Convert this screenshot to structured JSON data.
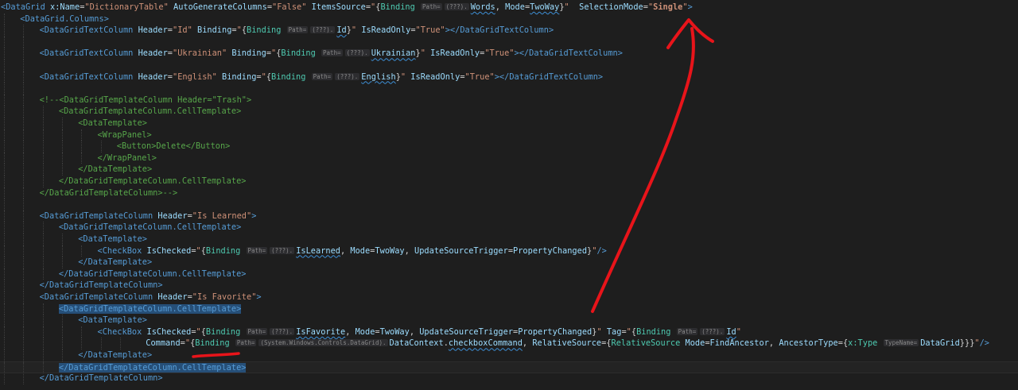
{
  "colors": {
    "background": "#1e1e1e",
    "tag": "#569cd6",
    "attribute": "#9cdcfe",
    "string": "#ce9178",
    "markup_extension": "#4ec9b0",
    "comment": "#57a64a",
    "property": "#dcdcaa",
    "selection": "#264f78",
    "annotation": "#e8141a"
  },
  "code_lines": [
    {
      "indent": 0,
      "tokens": [
        {
          "t": "<",
          "c": "t-tag"
        },
        {
          "t": "DataGrid",
          "c": "t-tag"
        },
        {
          "t": " x:Name",
          "c": "t-attr"
        },
        {
          "t": "=",
          "c": "t-brace"
        },
        {
          "t": "\"DictionaryTable\"",
          "c": "t-str"
        },
        {
          "t": " AutoGenerateColumns",
          "c": "t-attr"
        },
        {
          "t": "=",
          "c": "t-brace"
        },
        {
          "t": "\"False\"",
          "c": "t-str"
        },
        {
          "t": " ItemsSource",
          "c": "t-attr"
        },
        {
          "t": "=",
          "c": "t-brace"
        },
        {
          "t": "\"",
          "c": "t-str"
        },
        {
          "t": "{",
          "c": "t-brace"
        },
        {
          "t": "Binding",
          "c": "t-ext"
        },
        {
          "t": " "
        },
        {
          "t": "Path=",
          "c": "t-inlay"
        },
        {
          "t": "(???).",
          "c": "t-inlay"
        },
        {
          "t": "Words",
          "c": "t-path",
          "sq": true
        },
        {
          "t": ", ",
          "c": "t-brace"
        },
        {
          "t": "Mode",
          "c": "t-attr"
        },
        {
          "t": "=",
          "c": "t-brace"
        },
        {
          "t": "TwoWay",
          "c": "t-attr",
          "sq": true
        },
        {
          "t": "}",
          "c": "t-brace"
        },
        {
          "t": "\"",
          "c": "t-str"
        },
        {
          "t": "  SelectionMode",
          "c": "t-attr"
        },
        {
          "t": "=",
          "c": "t-brace"
        },
        {
          "t": "\"",
          "c": "t-str"
        },
        {
          "t": "Single",
          "c": "t-bold"
        },
        {
          "t": "\"",
          "c": "t-str"
        },
        {
          "t": ">",
          "c": "t-tag"
        }
      ]
    },
    {
      "indent": 1,
      "tokens": [
        {
          "t": "<",
          "c": "t-tag"
        },
        {
          "t": "DataGrid.Columns",
          "c": "t-tag"
        },
        {
          "t": ">",
          "c": "t-tag"
        }
      ]
    },
    {
      "indent": 2,
      "tokens": [
        {
          "t": "<",
          "c": "t-tag"
        },
        {
          "t": "DataGridTextColumn",
          "c": "t-tag"
        },
        {
          "t": " Header",
          "c": "t-attr"
        },
        {
          "t": "=",
          "c": "t-brace"
        },
        {
          "t": "\"Id\"",
          "c": "t-str"
        },
        {
          "t": " Binding",
          "c": "t-attr"
        },
        {
          "t": "=",
          "c": "t-brace"
        },
        {
          "t": "\"",
          "c": "t-str"
        },
        {
          "t": "{",
          "c": "t-brace"
        },
        {
          "t": "Binding",
          "c": "t-ext"
        },
        {
          "t": " "
        },
        {
          "t": "Path=",
          "c": "t-inlay"
        },
        {
          "t": "(???).",
          "c": "t-inlay"
        },
        {
          "t": "Id",
          "c": "t-path",
          "sq": true
        },
        {
          "t": "}",
          "c": "t-brace"
        },
        {
          "t": "\"",
          "c": "t-str"
        },
        {
          "t": " IsReadOnly",
          "c": "t-attr"
        },
        {
          "t": "=",
          "c": "t-brace"
        },
        {
          "t": "\"True\"",
          "c": "t-str"
        },
        {
          "t": "></",
          "c": "t-tag"
        },
        {
          "t": "DataGridTextColumn",
          "c": "t-tag"
        },
        {
          "t": ">",
          "c": "t-tag"
        }
      ]
    },
    {
      "indent": 2,
      "tokens": []
    },
    {
      "indent": 2,
      "tokens": [
        {
          "t": "<",
          "c": "t-tag"
        },
        {
          "t": "DataGridTextColumn",
          "c": "t-tag"
        },
        {
          "t": " Header",
          "c": "t-attr"
        },
        {
          "t": "=",
          "c": "t-brace"
        },
        {
          "t": "\"Ukrainian\"",
          "c": "t-str"
        },
        {
          "t": " Binding",
          "c": "t-attr"
        },
        {
          "t": "=",
          "c": "t-brace"
        },
        {
          "t": "\"",
          "c": "t-str"
        },
        {
          "t": "{",
          "c": "t-brace"
        },
        {
          "t": "Binding",
          "c": "t-ext"
        },
        {
          "t": " "
        },
        {
          "t": "Path=",
          "c": "t-inlay"
        },
        {
          "t": "(???).",
          "c": "t-inlay"
        },
        {
          "t": "Ukrainian",
          "c": "t-path",
          "sq": true
        },
        {
          "t": "}",
          "c": "t-brace"
        },
        {
          "t": "\"",
          "c": "t-str"
        },
        {
          "t": " IsReadOnly",
          "c": "t-attr"
        },
        {
          "t": "=",
          "c": "t-brace"
        },
        {
          "t": "\"True\"",
          "c": "t-str"
        },
        {
          "t": "></",
          "c": "t-tag"
        },
        {
          "t": "DataGridTextColumn",
          "c": "t-tag"
        },
        {
          "t": ">",
          "c": "t-tag"
        }
      ]
    },
    {
      "indent": 2,
      "tokens": []
    },
    {
      "indent": 2,
      "tokens": [
        {
          "t": "<",
          "c": "t-tag"
        },
        {
          "t": "DataGridTextColumn",
          "c": "t-tag"
        },
        {
          "t": " Header",
          "c": "t-attr"
        },
        {
          "t": "=",
          "c": "t-brace"
        },
        {
          "t": "\"English\"",
          "c": "t-str"
        },
        {
          "t": " Binding",
          "c": "t-attr"
        },
        {
          "t": "=",
          "c": "t-brace"
        },
        {
          "t": "\"",
          "c": "t-str"
        },
        {
          "t": "{",
          "c": "t-brace"
        },
        {
          "t": "Binding",
          "c": "t-ext"
        },
        {
          "t": " "
        },
        {
          "t": "Path=",
          "c": "t-inlay"
        },
        {
          "t": "(???).",
          "c": "t-inlay"
        },
        {
          "t": "English",
          "c": "t-path",
          "sq": true
        },
        {
          "t": "}",
          "c": "t-brace"
        },
        {
          "t": "\"",
          "c": "t-str"
        },
        {
          "t": " IsReadOnly",
          "c": "t-attr"
        },
        {
          "t": "=",
          "c": "t-brace"
        },
        {
          "t": "\"True\"",
          "c": "t-str"
        },
        {
          "t": "></",
          "c": "t-tag"
        },
        {
          "t": "DataGridTextColumn",
          "c": "t-tag"
        },
        {
          "t": ">",
          "c": "t-tag"
        }
      ]
    },
    {
      "indent": 2,
      "tokens": []
    },
    {
      "indent": 2,
      "tokens": [
        {
          "t": "<!--<DataGridTemplateColumn Header=\"Trash\">",
          "c": "t-com"
        }
      ]
    },
    {
      "indent": 3,
      "tokens": [
        {
          "t": "<DataGridTemplateColumn.CellTemplate>",
          "c": "t-com"
        }
      ]
    },
    {
      "indent": 4,
      "tokens": [
        {
          "t": "<DataTemplate>",
          "c": "t-com"
        }
      ]
    },
    {
      "indent": 5,
      "tokens": [
        {
          "t": "<WrapPanel>",
          "c": "t-com"
        }
      ]
    },
    {
      "indent": 6,
      "tokens": [
        {
          "t": "<Button>Delete</Button>",
          "c": "t-com"
        }
      ]
    },
    {
      "indent": 5,
      "tokens": [
        {
          "t": "</WrapPanel>",
          "c": "t-com"
        }
      ]
    },
    {
      "indent": 4,
      "tokens": [
        {
          "t": "</DataTemplate>",
          "c": "t-com"
        }
      ]
    },
    {
      "indent": 3,
      "tokens": [
        {
          "t": "</DataGridTemplateColumn.CellTemplate>",
          "c": "t-com"
        }
      ]
    },
    {
      "indent": 2,
      "tokens": [
        {
          "t": "</DataGridTemplateColumn>-->",
          "c": "t-com"
        }
      ]
    },
    {
      "indent": 2,
      "tokens": []
    },
    {
      "indent": 2,
      "tokens": [
        {
          "t": "<",
          "c": "t-tag"
        },
        {
          "t": "DataGridTemplateColumn",
          "c": "t-tag"
        },
        {
          "t": " Header",
          "c": "t-attr"
        },
        {
          "t": "=",
          "c": "t-brace"
        },
        {
          "t": "\"Is Learned\"",
          "c": "t-str"
        },
        {
          "t": ">",
          "c": "t-tag"
        }
      ]
    },
    {
      "indent": 3,
      "tokens": [
        {
          "t": "<",
          "c": "t-tag"
        },
        {
          "t": "DataGridTemplateColumn.CellTemplate",
          "c": "t-tag"
        },
        {
          "t": ">",
          "c": "t-tag"
        }
      ]
    },
    {
      "indent": 4,
      "tokens": [
        {
          "t": "<",
          "c": "t-tag"
        },
        {
          "t": "DataTemplate",
          "c": "t-tag"
        },
        {
          "t": ">",
          "c": "t-tag"
        }
      ]
    },
    {
      "indent": 5,
      "tokens": [
        {
          "t": "<",
          "c": "t-tag"
        },
        {
          "t": "CheckBox",
          "c": "t-tag"
        },
        {
          "t": " IsChecked",
          "c": "t-attr"
        },
        {
          "t": "=",
          "c": "t-brace"
        },
        {
          "t": "\"",
          "c": "t-str"
        },
        {
          "t": "{",
          "c": "t-brace"
        },
        {
          "t": "Binding",
          "c": "t-ext"
        },
        {
          "t": " "
        },
        {
          "t": "Path=",
          "c": "t-inlay"
        },
        {
          "t": "(???).",
          "c": "t-inlay"
        },
        {
          "t": "IsLearned",
          "c": "t-path",
          "sq": true
        },
        {
          "t": ", ",
          "c": "t-brace"
        },
        {
          "t": "Mode",
          "c": "t-attr"
        },
        {
          "t": "=",
          "c": "t-brace"
        },
        {
          "t": "TwoWay",
          "c": "t-attr"
        },
        {
          "t": ", ",
          "c": "t-brace"
        },
        {
          "t": "UpdateSourceTrigger",
          "c": "t-attr"
        },
        {
          "t": "=",
          "c": "t-brace"
        },
        {
          "t": "PropertyChanged",
          "c": "t-attr"
        },
        {
          "t": "}",
          "c": "t-brace"
        },
        {
          "t": "\"",
          "c": "t-str"
        },
        {
          "t": "/>",
          "c": "t-tag"
        }
      ]
    },
    {
      "indent": 4,
      "tokens": [
        {
          "t": "</",
          "c": "t-tag"
        },
        {
          "t": "DataTemplate",
          "c": "t-tag"
        },
        {
          "t": ">",
          "c": "t-tag"
        }
      ]
    },
    {
      "indent": 3,
      "tokens": [
        {
          "t": "</",
          "c": "t-tag"
        },
        {
          "t": "DataGridTemplateColumn.CellTemplate",
          "c": "t-tag"
        },
        {
          "t": ">",
          "c": "t-tag"
        }
      ]
    },
    {
      "indent": 2,
      "tokens": [
        {
          "t": "</",
          "c": "t-tag"
        },
        {
          "t": "DataGridTemplateColumn",
          "c": "t-tag"
        },
        {
          "t": ">",
          "c": "t-tag"
        }
      ]
    },
    {
      "indent": 2,
      "tokens": [
        {
          "t": "<",
          "c": "t-tag"
        },
        {
          "t": "DataGridTemplateColumn",
          "c": "t-tag"
        },
        {
          "t": " Header",
          "c": "t-attr"
        },
        {
          "t": "=",
          "c": "t-brace"
        },
        {
          "t": "\"Is Favorite\"",
          "c": "t-str"
        },
        {
          "t": ">",
          "c": "t-tag"
        }
      ]
    },
    {
      "indent": 3,
      "tokens": [
        {
          "t": "<DataGridTemplateColumn.CellTemplate>",
          "c": "t-tag",
          "hl": true
        }
      ]
    },
    {
      "indent": 4,
      "tokens": [
        {
          "t": "<",
          "c": "t-tag"
        },
        {
          "t": "DataTemplate",
          "c": "t-tag"
        },
        {
          "t": ">",
          "c": "t-tag"
        }
      ]
    },
    {
      "indent": 5,
      "tokens": [
        {
          "t": "<",
          "c": "t-tag"
        },
        {
          "t": "CheckBox",
          "c": "t-tag"
        },
        {
          "t": " IsChecked",
          "c": "t-attr"
        },
        {
          "t": "=",
          "c": "t-brace"
        },
        {
          "t": "\"",
          "c": "t-str"
        },
        {
          "t": "{",
          "c": "t-brace"
        },
        {
          "t": "Binding",
          "c": "t-ext"
        },
        {
          "t": " "
        },
        {
          "t": "Path=",
          "c": "t-inlay"
        },
        {
          "t": "(???).",
          "c": "t-inlay"
        },
        {
          "t": "IsFavorite",
          "c": "t-path",
          "sq": true
        },
        {
          "t": ", ",
          "c": "t-brace"
        },
        {
          "t": "Mode",
          "c": "t-attr"
        },
        {
          "t": "=",
          "c": "t-brace"
        },
        {
          "t": "TwoWay",
          "c": "t-attr"
        },
        {
          "t": ", ",
          "c": "t-brace"
        },
        {
          "t": "UpdateSourceTrigger",
          "c": "t-attr"
        },
        {
          "t": "=",
          "c": "t-brace"
        },
        {
          "t": "PropertyChanged",
          "c": "t-attr"
        },
        {
          "t": "}",
          "c": "t-brace"
        },
        {
          "t": "\"",
          "c": "t-str"
        },
        {
          "t": " Tag",
          "c": "t-attr"
        },
        {
          "t": "=",
          "c": "t-brace"
        },
        {
          "t": "\"",
          "c": "t-str"
        },
        {
          "t": "{",
          "c": "t-brace"
        },
        {
          "t": "Binding",
          "c": "t-ext"
        },
        {
          "t": " "
        },
        {
          "t": "Path=",
          "c": "t-inlay"
        },
        {
          "t": "(???).",
          "c": "t-inlay"
        },
        {
          "t": "Id",
          "c": "t-path",
          "sq": true
        },
        {
          "t": "\"",
          "c": "t-str"
        }
      ]
    },
    {
      "indent": 7.5,
      "tokens": [
        {
          "t": "Command",
          "c": "t-attr"
        },
        {
          "t": "=",
          "c": "t-brace"
        },
        {
          "t": "\"",
          "c": "t-str"
        },
        {
          "t": "{",
          "c": "t-brace"
        },
        {
          "t": "Binding",
          "c": "t-ext"
        },
        {
          "t": " "
        },
        {
          "t": "Path=",
          "c": "t-inlay"
        },
        {
          "t": "(System.Windows.Controls.DataGrid).",
          "c": "t-inlay"
        },
        {
          "t": "DataContext",
          "c": "t-path"
        },
        {
          "t": ".",
          "c": "t-brace"
        },
        {
          "t": "checkboxCommand",
          "c": "t-path",
          "sq": true
        },
        {
          "t": ", ",
          "c": "t-brace"
        },
        {
          "t": "RelativeSource",
          "c": "t-attr"
        },
        {
          "t": "=",
          "c": "t-brace"
        },
        {
          "t": "{",
          "c": "t-brace"
        },
        {
          "t": "RelativeSource",
          "c": "t-ext"
        },
        {
          "t": " Mode",
          "c": "t-attr"
        },
        {
          "t": "=",
          "c": "t-brace"
        },
        {
          "t": "FindAncestor",
          "c": "t-attr"
        },
        {
          "t": ", ",
          "c": "t-brace"
        },
        {
          "t": "AncestorType",
          "c": "t-attr"
        },
        {
          "t": "=",
          "c": "t-brace"
        },
        {
          "t": "{",
          "c": "t-brace"
        },
        {
          "t": "x:Type",
          "c": "t-ext"
        },
        {
          "t": " "
        },
        {
          "t": "TypeName=",
          "c": "t-inlay"
        },
        {
          "t": "DataGrid",
          "c": "t-path"
        },
        {
          "t": "}}}",
          "c": "t-brace"
        },
        {
          "t": "\"",
          "c": "t-str"
        },
        {
          "t": "/>",
          "c": "t-tag"
        }
      ]
    },
    {
      "indent": 4,
      "tokens": [
        {
          "t": "</",
          "c": "t-tag"
        },
        {
          "t": "DataTemplate",
          "c": "t-tag"
        },
        {
          "t": ">",
          "c": "t-tag"
        }
      ]
    },
    {
      "indent": 3,
      "current": true,
      "tokens": [
        {
          "t": "</DataGridTemplateColumn.CellTemplate>",
          "c": "t-tag",
          "hl": true
        }
      ]
    },
    {
      "indent": 2,
      "tokens": [
        {
          "t": "</",
          "c": "t-tag"
        },
        {
          "t": "DataGridTemplateColumn",
          "c": "t-tag"
        },
        {
          "t": ">",
          "c": "t-tag"
        }
      ]
    }
  ]
}
